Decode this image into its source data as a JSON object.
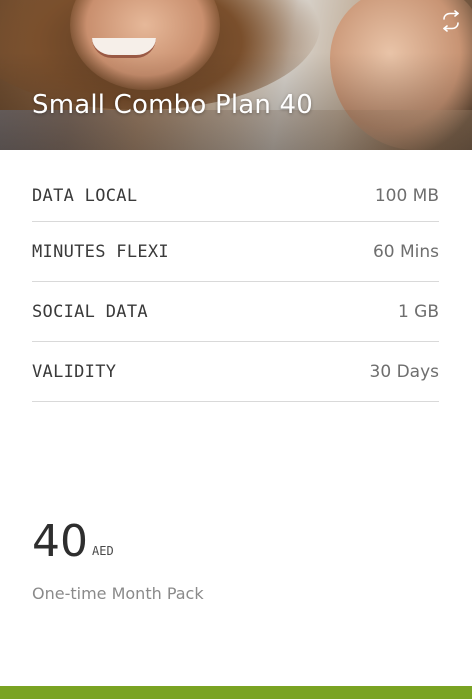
{
  "plan": {
    "title": "Small Combo Plan 40",
    "features": [
      {
        "label": "DATA LOCAL",
        "value": "100 MB"
      },
      {
        "label": "MINUTES FLEXI",
        "value": "60 Mins"
      },
      {
        "label": "SOCIAL DATA",
        "value": "1 GB"
      },
      {
        "label": "VALIDITY",
        "value": "30 Days"
      }
    ],
    "price": {
      "amount": "40",
      "currency": "AED",
      "description": "One-time Month Pack"
    }
  },
  "icons": {
    "swap": "swap-arrows-icon"
  },
  "colors": {
    "accent_bar": "#7aa322",
    "title_text": "#ffffff",
    "label_text": "#3a3a3a",
    "value_text": "#6e6e6e",
    "divider": "#d9d9d9"
  }
}
